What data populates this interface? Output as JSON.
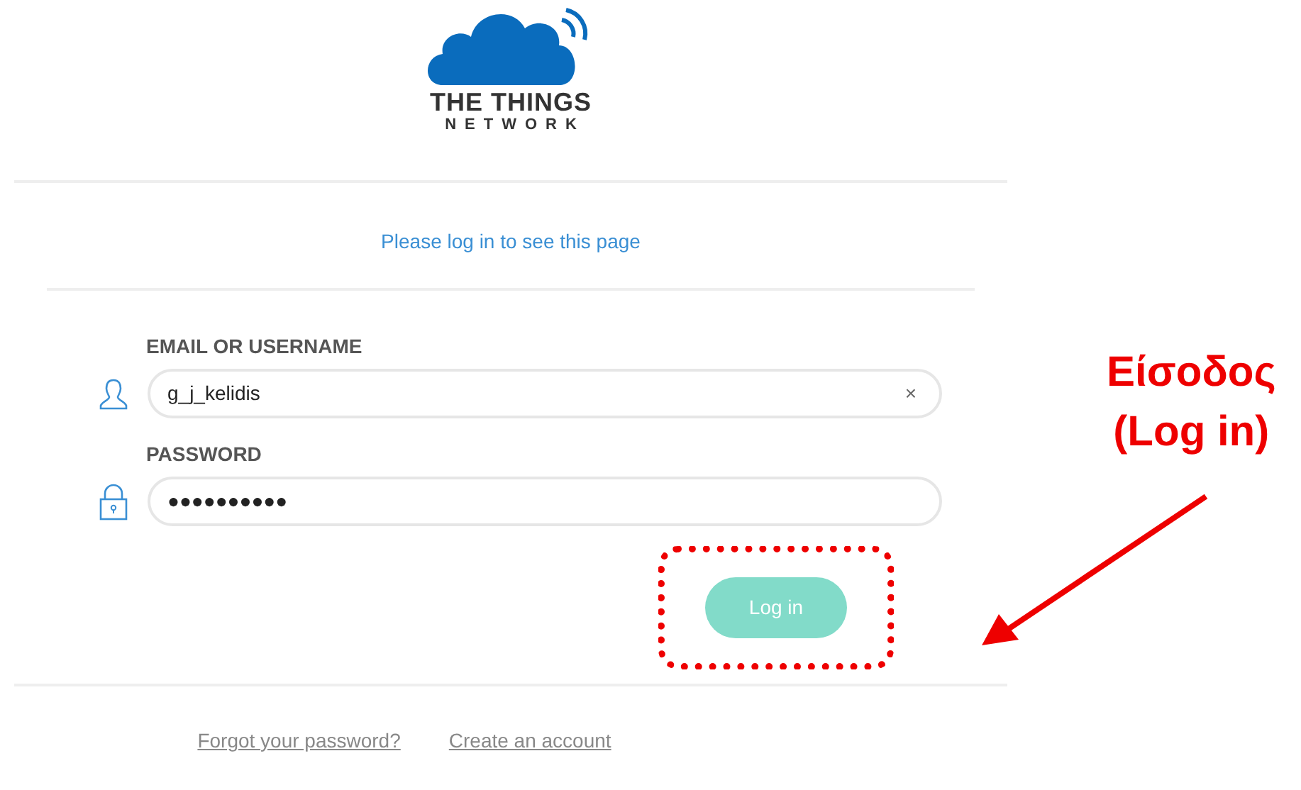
{
  "logo": {
    "line_1": "THE THINGS",
    "line_2": "NETWORK"
  },
  "prompt": "Please log in to see this page",
  "fields": [
    {
      "kind": "user",
      "label": "EMAIL OR USERNAME",
      "value": "g_j_kelidis",
      "clear": "×"
    },
    {
      "kind": "lock",
      "label": "PASSWORD",
      "value": "●●●●●●●●●●"
    }
  ],
  "login_button": "Log in",
  "links": [
    "Forgot your password?",
    "Create an account"
  ],
  "annotation": {
    "title": "Είσοδος",
    "subtitle": "(Log in)"
  }
}
